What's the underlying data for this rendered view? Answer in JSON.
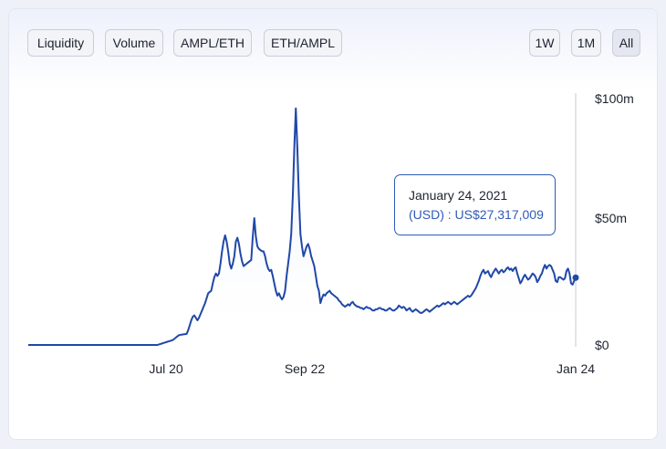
{
  "toolbar": {
    "left_buttons": [
      "Liquidity",
      "Volume",
      "AMPL/ETH",
      "ETH/AMPL"
    ],
    "right_buttons": [
      "1W",
      "1M",
      "All"
    ],
    "active_range": "All"
  },
  "tooltip": {
    "date": "January 24, 2021",
    "value": "(USD) : US$27,317,009"
  },
  "colors": {
    "line": "#2048a8",
    "area_top": "#dde5f7",
    "tooltip_border": "#2f5bb5",
    "cursor_line": "#d7dbe3"
  },
  "chart_data": {
    "type": "area",
    "title": "",
    "xlabel": "",
    "ylabel": "",
    "x_ticks": [
      "Jul 20",
      "Sep 22",
      "Jan 24"
    ],
    "y_ticks": [
      "$0",
      "$50m",
      "$100m"
    ],
    "ylim": [
      0,
      100000000
    ],
    "series": [
      {
        "values": [
          0,
          0,
          0,
          0,
          0,
          0,
          0,
          0,
          0,
          0,
          0,
          0,
          0,
          0,
          0,
          0,
          0,
          0,
          0,
          0,
          0,
          0,
          0,
          0,
          0,
          0,
          0,
          0,
          0,
          0,
          0,
          0,
          0,
          0,
          0,
          0,
          0,
          0,
          0,
          0,
          0,
          0,
          0,
          0,
          0,
          0,
          0,
          0,
          0,
          0,
          0,
          0,
          0,
          0,
          0,
          0,
          0,
          0,
          0,
          0,
          0,
          0,
          0,
          0,
          0,
          0,
          0,
          0,
          0,
          0,
          0,
          0,
          0,
          0,
          0,
          0,
          0,
          0,
          0,
          0,
          0,
          0,
          0,
          0,
          0,
          200000,
          400000,
          600000,
          800000,
          1000000,
          1200000,
          1400000,
          1600000,
          1800000,
          2000000,
          2500000,
          3000000,
          3500000,
          4000000,
          4100000,
          4200000,
          4300000,
          4400000,
          4500000,
          6000000,
          8000000,
          10000000,
          11500000,
          12000000,
          11000000,
          10000000,
          11000000,
          12500000,
          14000000,
          15500000,
          17000000,
          19000000,
          21000000,
          21500000,
          22000000,
          25000000,
          27500000,
          29000000,
          28000000,
          29000000,
          33000000,
          38000000,
          42000000,
          44500000,
          42000000,
          38000000,
          33000000,
          31000000,
          33000000,
          36000000,
          42000000,
          43500000,
          41000000,
          37000000,
          34000000,
          32000000,
          32500000,
          33000000,
          33500000,
          34000000,
          34500000,
          44000000,
          51500000,
          44000000,
          40000000,
          39000000,
          38500000,
          38000000,
          38000000,
          36000000,
          33000000,
          31000000,
          30000000,
          30500000,
          28000000,
          25000000,
          22000000,
          20000000,
          21000000,
          19500000,
          18500000,
          19500000,
          22000000,
          28000000,
          33000000,
          38000000,
          45000000,
          60000000,
          80000000,
          96000000,
          80000000,
          60000000,
          45000000,
          40000000,
          36000000,
          38000000,
          40000000,
          41000000,
          39000000,
          36000000,
          34000000,
          32000000,
          28000000,
          24000000,
          22000000,
          17000000,
          19000000,
          20500000,
          20000000,
          21000000,
          21500000,
          22000000,
          21000000,
          20500000,
          20000000,
          19500000,
          19000000,
          18000000,
          17500000,
          16500000,
          16000000,
          15500000,
          16000000,
          16500000,
          16000000,
          17000000,
          17500000,
          16500000,
          16000000,
          15500000,
          15500000,
          15000000,
          15000000,
          14500000,
          15000000,
          15500000,
          15000000,
          15000000,
          14500000,
          14000000,
          14000000,
          14500000,
          14500000,
          15000000,
          15000000,
          14500000,
          14500000,
          14000000,
          14000000,
          14500000,
          15000000,
          14500000,
          14000000,
          14000000,
          14500000,
          15000000,
          16000000,
          15500000,
          15000000,
          15500000,
          15000000,
          14000000,
          14500000,
          15000000,
          14000000,
          13500000,
          14000000,
          14500000,
          14000000,
          13500000,
          13000000,
          13000000,
          13500000,
          14000000,
          14500000,
          14000000,
          13500000,
          14000000,
          14500000,
          15000000,
          15500000,
          16000000,
          15500000,
          16000000,
          16500000,
          17000000,
          16500000,
          17000000,
          17500000,
          17000000,
          16500000,
          17000000,
          17500000,
          17000000,
          16500000,
          17000000,
          17500000,
          18000000,
          18500000,
          19000000,
          19500000,
          20000000,
          19500000,
          20000000,
          21000000,
          22000000,
          23000000,
          24500000,
          26000000,
          28000000,
          29500000,
          30500000,
          29000000,
          29500000,
          30000000,
          28500000,
          27500000,
          29000000,
          30000000,
          31000000,
          30000000,
          29000000,
          30000000,
          30500000,
          29500000,
          30000000,
          31000000,
          31500000,
          30500000,
          31000000,
          30000000,
          31000000,
          31500000,
          29000000,
          27000000,
          25000000,
          26000000,
          27500000,
          28500000,
          27500000,
          26500000,
          27000000,
          28000000,
          29000000,
          28500000,
          27500000,
          25500000,
          26500000,
          28000000,
          29000000,
          31000000,
          32500000,
          31000000,
          32000000,
          32500000,
          32000000,
          30500000,
          29000000,
          26000000,
          25500000,
          27500000,
          27500000,
          27000000,
          26500000,
          27000000,
          30000000,
          31000000,
          29000000,
          25000000,
          24500000,
          26000000,
          27317009
        ]
      }
    ]
  }
}
